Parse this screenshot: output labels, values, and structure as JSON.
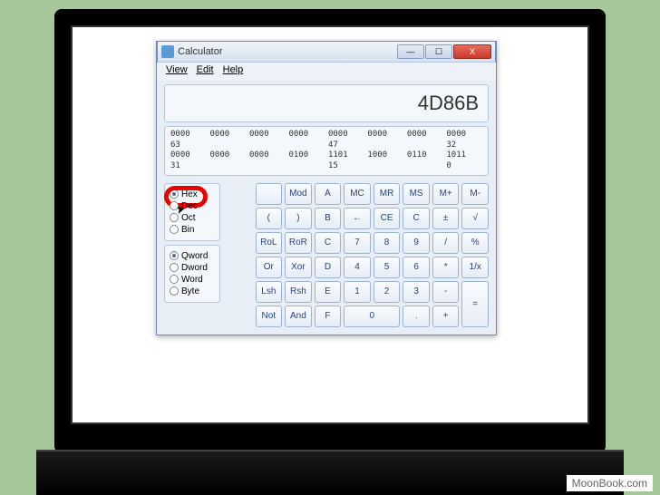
{
  "watermark": "MoonBook.com",
  "window": {
    "title": "Calculator",
    "min": "—",
    "max": "☐",
    "close": "X"
  },
  "menu": {
    "view": "View",
    "edit": "Edit",
    "help": "Help"
  },
  "display": "4D86B",
  "bits": {
    "row1": [
      "0000",
      "0000",
      "0000",
      "0000",
      "0000",
      "0000",
      "0000",
      "0000"
    ],
    "row1_labels": [
      "63",
      "",
      "",
      "",
      "47",
      "",
      "",
      "32"
    ],
    "row2": [
      "0000",
      "0000",
      "0000",
      "0100",
      "1101",
      "1000",
      "0110",
      "1011"
    ],
    "row2_labels": [
      "31",
      "",
      "",
      "",
      "15",
      "",
      "",
      "0"
    ]
  },
  "radios": {
    "base": {
      "hex": "Hex",
      "dec": "Dec",
      "oct": "Oct",
      "bin": "Bin",
      "selected": "hex"
    },
    "size": {
      "qword": "Qword",
      "dword": "Dword",
      "word": "Word",
      "byte": "Byte",
      "selected": "qword"
    }
  },
  "keys": {
    "r1": [
      "",
      "Mod",
      "A",
      "MC",
      "MR",
      "MS",
      "M+",
      "M-"
    ],
    "r2": [
      "(",
      ")",
      "B",
      "←",
      "CE",
      "C",
      "±",
      "√"
    ],
    "r3": [
      "RoL",
      "RoR",
      "C",
      "7",
      "8",
      "9",
      "/",
      "%"
    ],
    "r4": [
      "Or",
      "Xor",
      "D",
      "4",
      "5",
      "6",
      "*",
      "1/x"
    ],
    "r5": [
      "Lsh",
      "Rsh",
      "E",
      "1",
      "2",
      "3",
      "-",
      "="
    ],
    "r6": [
      "Not",
      "And",
      "F",
      "0",
      "",
      ".",
      "+",
      ""
    ]
  }
}
